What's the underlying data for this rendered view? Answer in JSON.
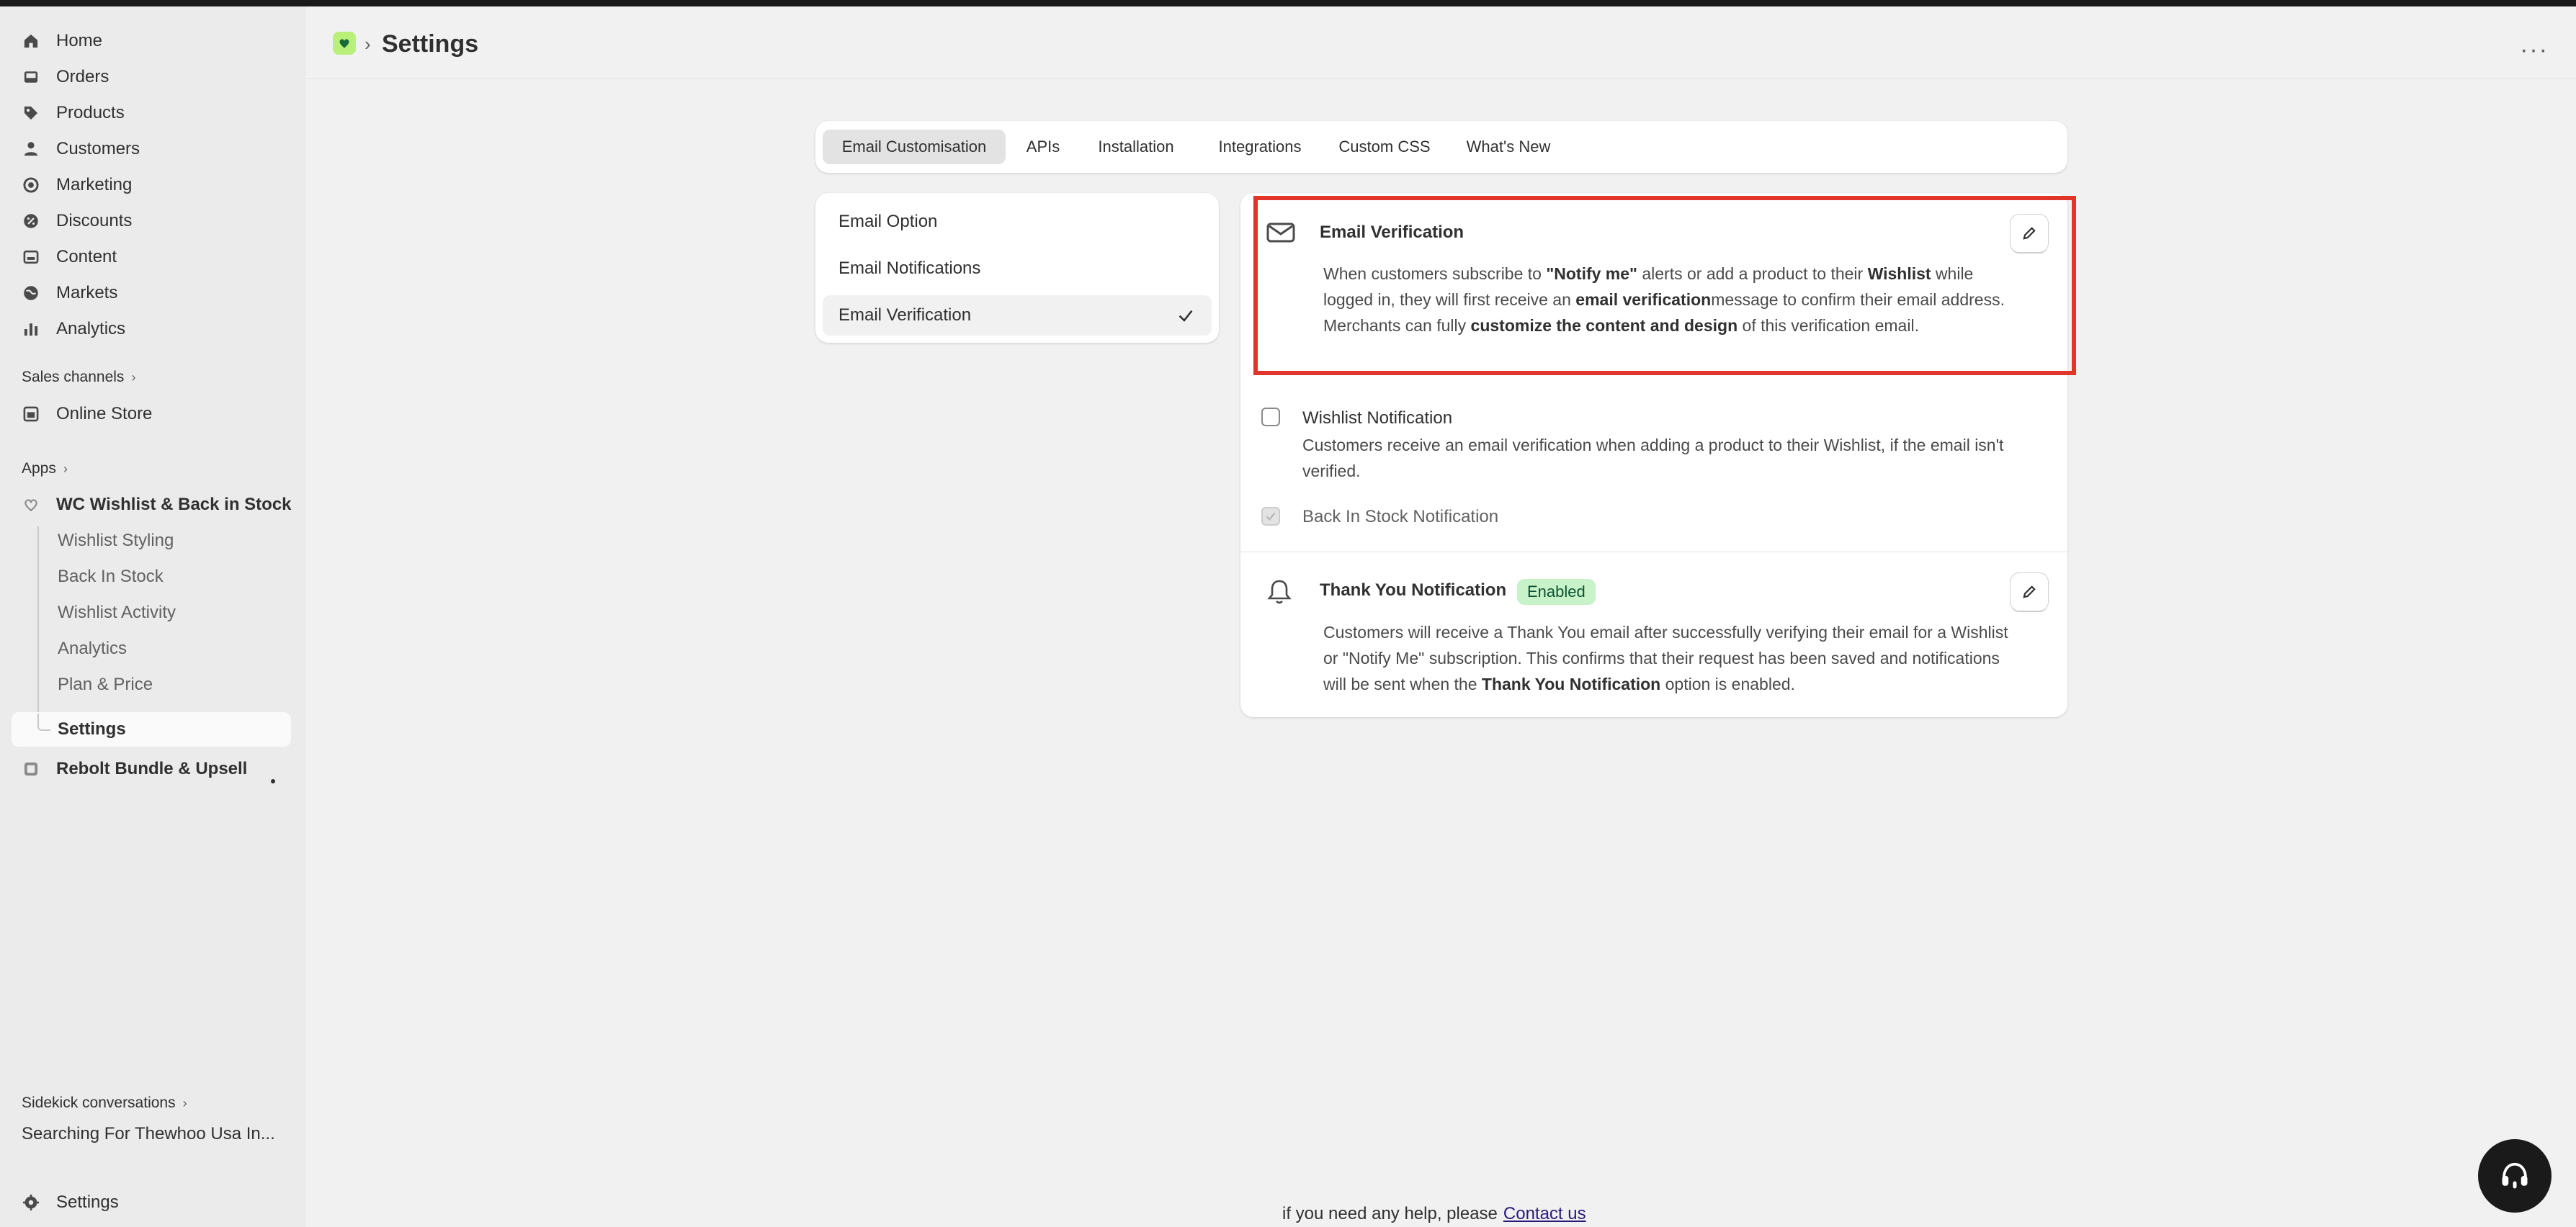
{
  "sidebar": {
    "nav": [
      {
        "label": "Home",
        "icon": "home-icon"
      },
      {
        "label": "Orders",
        "icon": "inbox-icon"
      },
      {
        "label": "Products",
        "icon": "tag-icon"
      },
      {
        "label": "Customers",
        "icon": "person-icon"
      },
      {
        "label": "Marketing",
        "icon": "target-icon"
      },
      {
        "label": "Discounts",
        "icon": "discount-icon"
      },
      {
        "label": "Content",
        "icon": "content-icon"
      },
      {
        "label": "Markets",
        "icon": "globe-icon"
      },
      {
        "label": "Analytics",
        "icon": "bar-chart-icon"
      }
    ],
    "sales_channels_label": "Sales channels",
    "online_store_label": "Online Store",
    "apps_label": "Apps",
    "app_name": "WC Wishlist & Back in Stock",
    "app_subitems": [
      "Wishlist Styling",
      "Back In Stock",
      "Wishlist Activity",
      "Analytics",
      "Plan & Price",
      "Settings"
    ],
    "other_app": "Rebolt Bundle & Upsell",
    "sidekick_label": "Sidekick conversations",
    "sidekick_item": "Searching For Thewhoo Usa In...",
    "settings_label": "Settings"
  },
  "header": {
    "title": "Settings"
  },
  "tabs": [
    "Email Customisation",
    "APIs",
    "Installation",
    "Integrations",
    "Custom CSS",
    "What's New"
  ],
  "email_options": [
    "Email Option",
    "Email Notifications",
    "Email Verification"
  ],
  "verification": {
    "title": "Email Verification",
    "desc_parts": [
      "When customers subscribe to ",
      "\"Notify me\"",
      " alerts or add a product to their ",
      "Wishlist",
      " while logged in, they will first receive an ",
      "email verification",
      "message to confirm their email address. Merchants can fully ",
      "customize the content and design",
      " of this verification email."
    ]
  },
  "wishlist_notification": {
    "label": "Wishlist Notification",
    "desc": "Customers receive an email verification when adding a product to their Wishlist, if the email isn't verified."
  },
  "back_in_stock": {
    "label": "Back In Stock Notification"
  },
  "thank_you": {
    "title": "Thank You Notification",
    "badge": "Enabled",
    "desc_parts": [
      "Customers will receive a Thank You email after successfully verifying their email for a Wishlist or \"Notify Me\" subscription. This confirms that their request has been saved and notifications will be sent when the ",
      "Thank You Notification",
      " option is enabled."
    ]
  },
  "footer": {
    "text": "if you need any help, please",
    "link": "Contact us"
  },
  "colors": {
    "highlight": "#e0352a",
    "badge_bg": "#c8f3c8",
    "badge_text": "#0c5132",
    "app_logo": "#b9f07a"
  }
}
